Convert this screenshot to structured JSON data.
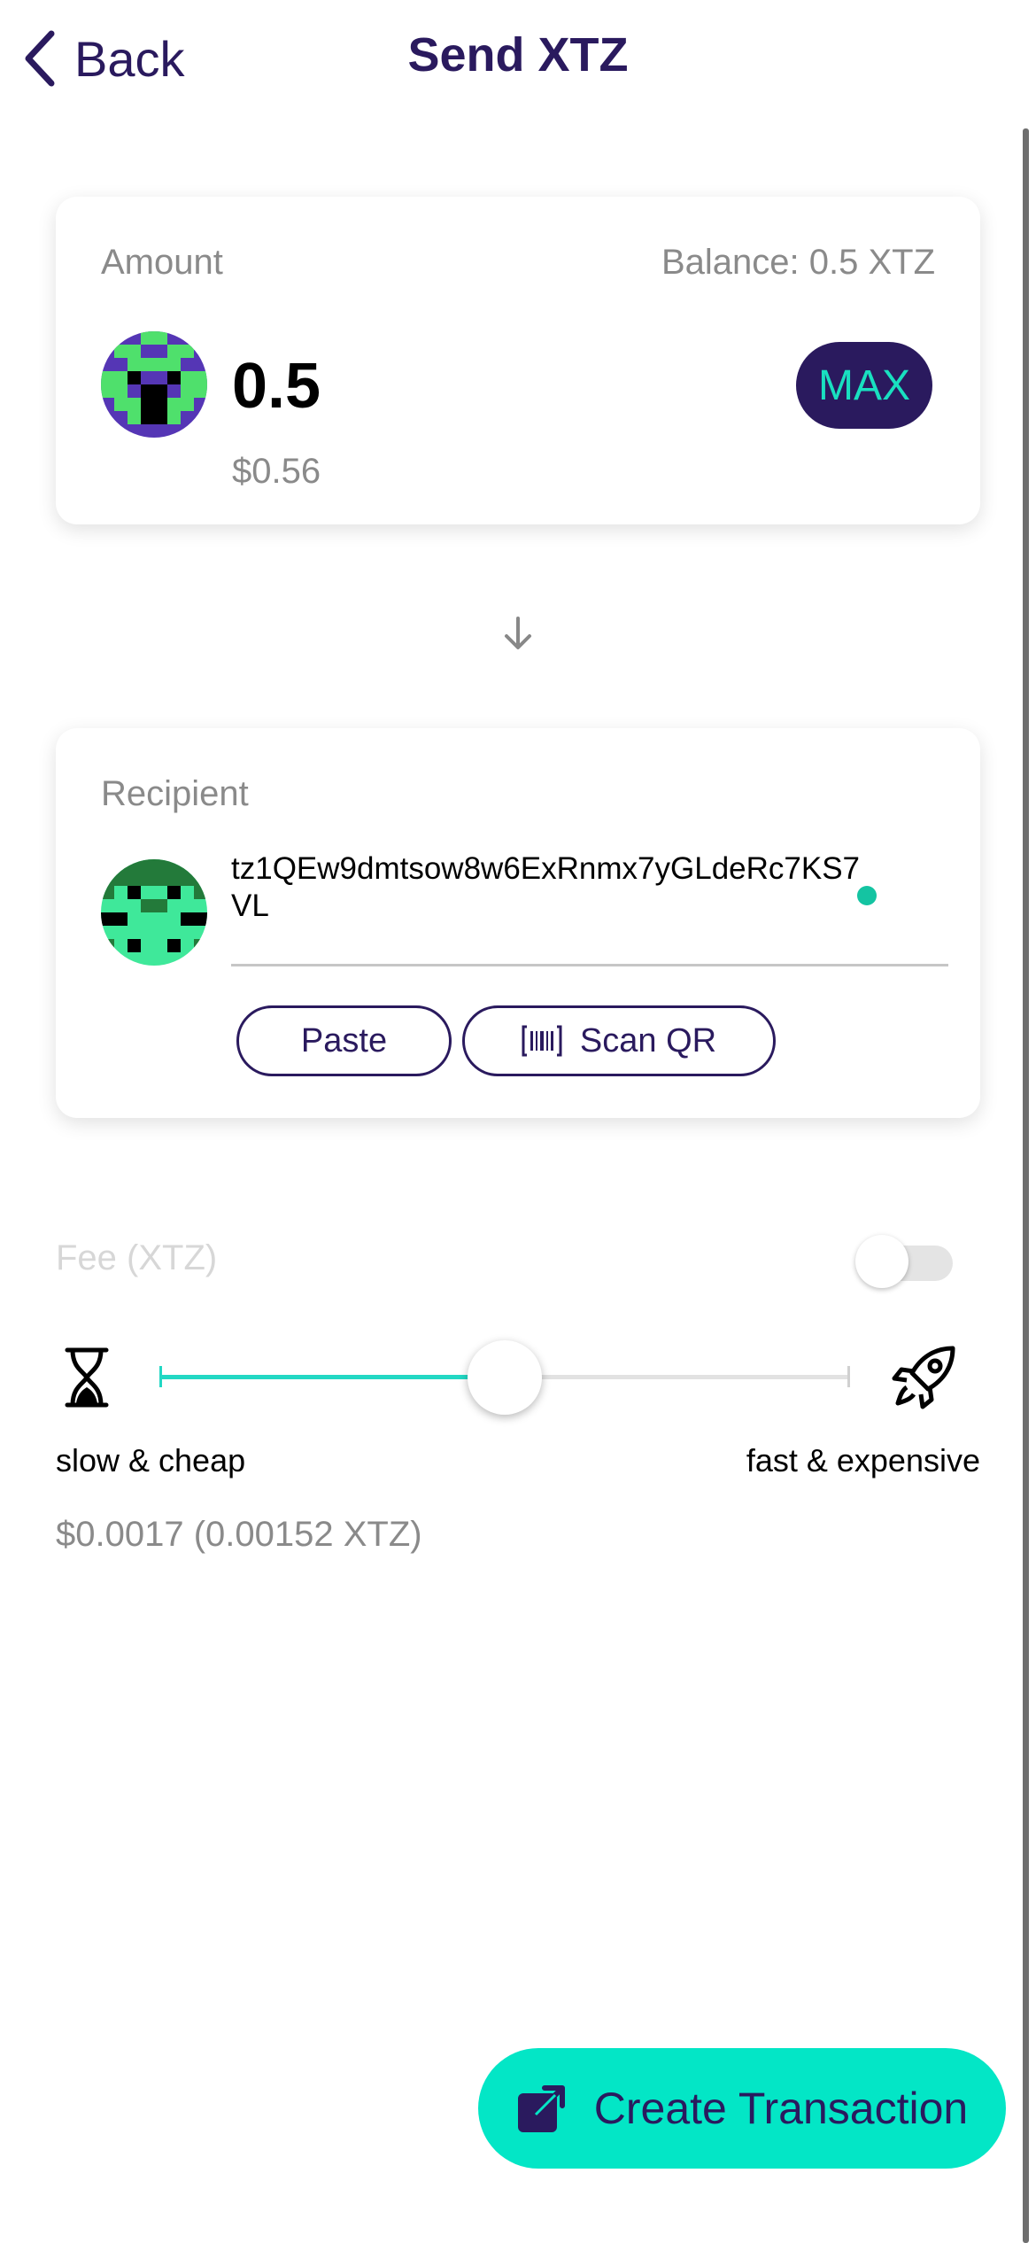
{
  "header": {
    "back_label": "Back",
    "title": "Send XTZ"
  },
  "amount_card": {
    "label": "Amount",
    "balance": "Balance: 0.5 XTZ",
    "value": "0.5",
    "fiat": "$0.56",
    "max_label": "MAX",
    "avatar_icon": "token-avatar-icon"
  },
  "recipient_card": {
    "label": "Recipient",
    "address": "tz1QEw9dmtsow8w6ExRnmx7yGLdeRc7KS7VL",
    "avatar_icon": "recipient-avatar-icon",
    "paste_label": "Paste",
    "scan_label": "Scan QR"
  },
  "fee": {
    "label": "Fee (XTZ)",
    "custom_enabled": false,
    "slider_level": 0.5,
    "slow_label": "slow & cheap",
    "fast_label": "fast & expensive",
    "value": "$0.0017 (0.00152 XTZ)"
  },
  "actions": {
    "create_label": "Create Transaction"
  },
  "colors": {
    "brand_dark": "#2a1a5e",
    "accent": "#03e6c6",
    "muted_text": "#8a8a8a"
  }
}
